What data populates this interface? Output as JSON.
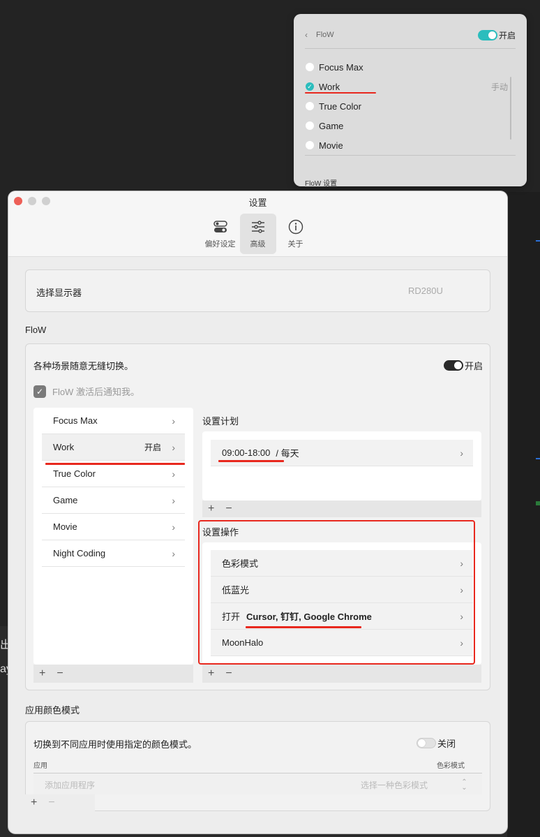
{
  "popover": {
    "back_glyph": "‹",
    "title": "FloW",
    "toggle_label": "开启",
    "items": [
      {
        "label": "Focus Max",
        "checked": false,
        "note": ""
      },
      {
        "label": "Work",
        "checked": true,
        "note": "手动"
      },
      {
        "label": "True Color",
        "checked": false,
        "note": ""
      },
      {
        "label": "Game",
        "checked": false,
        "note": ""
      },
      {
        "label": "Movie",
        "checked": false,
        "note": ""
      }
    ],
    "footer_link": "FloW 设置",
    "check_glyph": "✓"
  },
  "window": {
    "title": "设置",
    "toolbar": [
      {
        "label": "偏好设定",
        "icon": "toggles-icon",
        "active": false
      },
      {
        "label": "高级",
        "icon": "sliders-icon",
        "active": true
      },
      {
        "label": "关于",
        "icon": "info-icon",
        "active": false
      }
    ]
  },
  "display": {
    "label": "选择显示器",
    "value": "RD280U"
  },
  "flow": {
    "section_title": "FloW",
    "description": "各种场景随意无缝切换。",
    "toggle_label": "开启",
    "notify_label": "FloW 激活后通知我。",
    "check_glyph": "✓",
    "scenes": [
      {
        "label": "Focus Max",
        "state": ""
      },
      {
        "label": "Work",
        "state": "开启"
      },
      {
        "label": "True Color",
        "state": ""
      },
      {
        "label": "Game",
        "state": ""
      },
      {
        "label": "Movie",
        "state": ""
      },
      {
        "label": "Night Coding",
        "state": ""
      }
    ],
    "chevron": "›",
    "add": "+",
    "remove": "−",
    "schedule_title": "设置计划",
    "schedule_time": "09:00-18:00",
    "schedule_repeat": "/ 每天",
    "actions_title": "设置操作",
    "actions": [
      {
        "prefix": "色彩模式",
        "bold": ""
      },
      {
        "prefix": "低蓝光",
        "bold": ""
      },
      {
        "prefix": "打开",
        "bold": "Cursor, 钉钉, Google Chrome"
      },
      {
        "prefix": "MoonHalo",
        "bold": ""
      }
    ]
  },
  "app_color": {
    "section_title": "应用颜色模式",
    "description": "切换到不同应用时使用指定的颜色模式。",
    "toggle_label": "关闭",
    "col_app": "应用",
    "col_mode": "色彩模式",
    "add_placeholder": "添加应用程序",
    "mode_placeholder": "选择一种色彩模式",
    "stepper_glyph": "⌃⌄"
  },
  "background": {
    "left_text_1": "出",
    "left_text_2": "ay"
  },
  "colors": {
    "accent_teal": "#2bbdbd",
    "annotation_red": "#e8281e"
  }
}
